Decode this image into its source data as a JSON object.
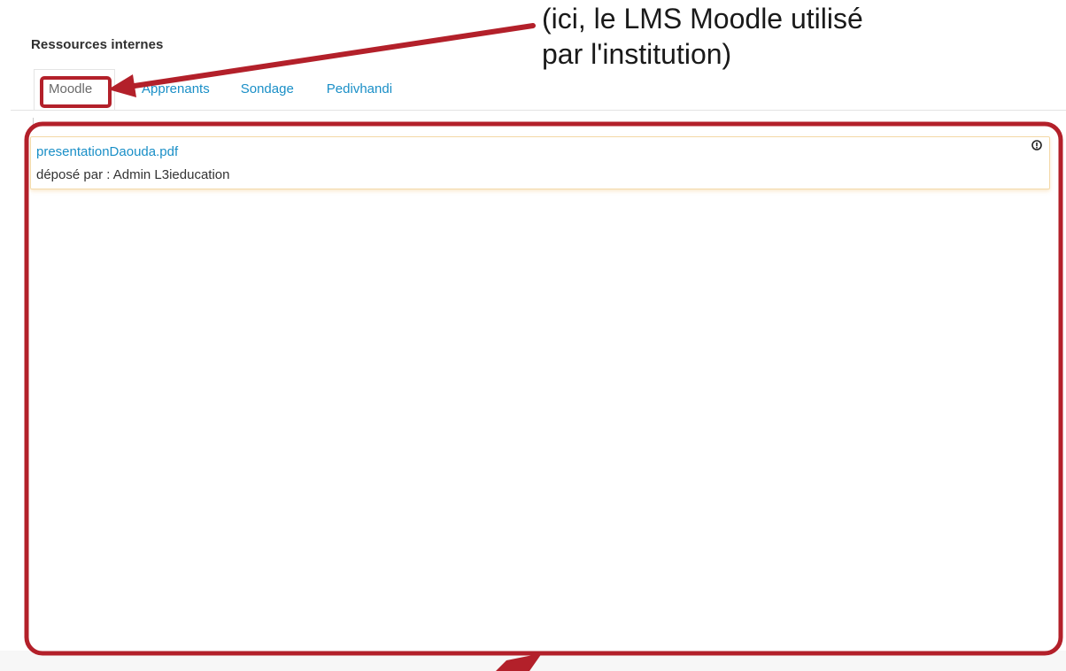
{
  "section": {
    "title": "Ressources internes"
  },
  "tabs": [
    {
      "label": "Moodle",
      "active": true
    },
    {
      "label": "Apprenants",
      "active": false
    },
    {
      "label": "Sondage",
      "active": false
    },
    {
      "label": "Pedivhandi",
      "active": false
    }
  ],
  "resource": {
    "file_name": "presentationDaouda.pdf",
    "uploaded_by": "déposé par : Admin L3ieducation",
    "download_icon": "download-icon"
  },
  "annotation": {
    "line1": "(ici, le LMS Moodle utilisé",
    "line2": "par l'institution)",
    "color": "#b3202a"
  },
  "colors": {
    "link": "#1a8fc7",
    "annotation": "#b3202a",
    "card_border": "#f3d9a8"
  }
}
